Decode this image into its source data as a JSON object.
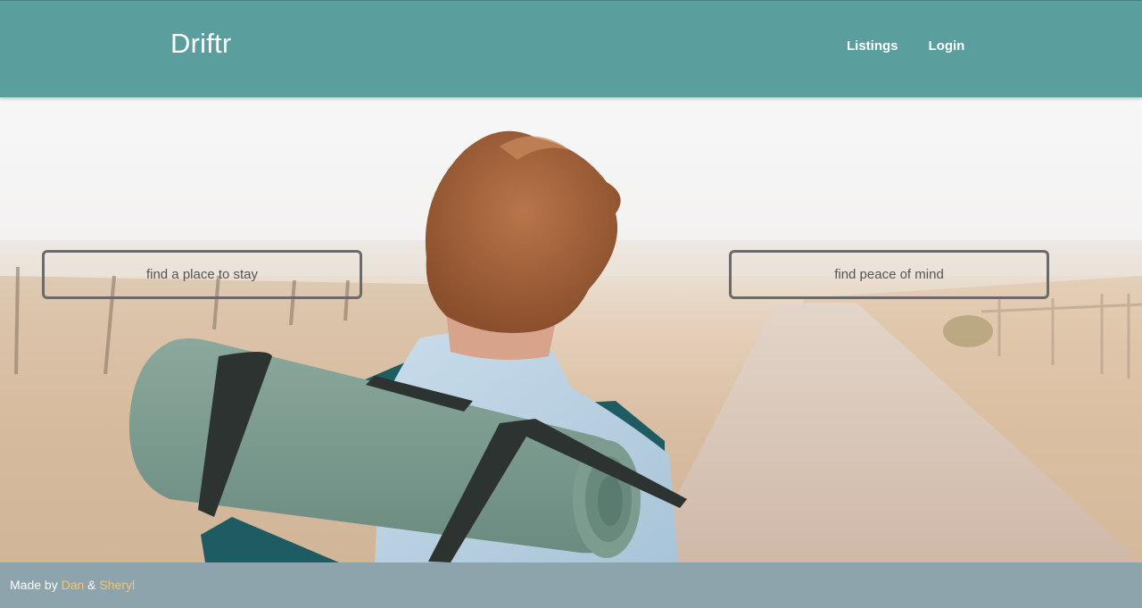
{
  "brand": {
    "name": "Driftr"
  },
  "nav": {
    "items": [
      {
        "label": "Listings"
      },
      {
        "label": "Login"
      }
    ]
  },
  "hero": {
    "left_button": "find a place to stay",
    "right_button": "find peace of mind"
  },
  "footer": {
    "prefix": "Made by",
    "author1": "Dan",
    "separator": "&",
    "author2": "Sheryl"
  },
  "colors": {
    "navbar": "#5b9e9e",
    "footer": "#8ea4ad",
    "footer_link": "#f5c46e",
    "button_border": "#6a6a6a"
  }
}
